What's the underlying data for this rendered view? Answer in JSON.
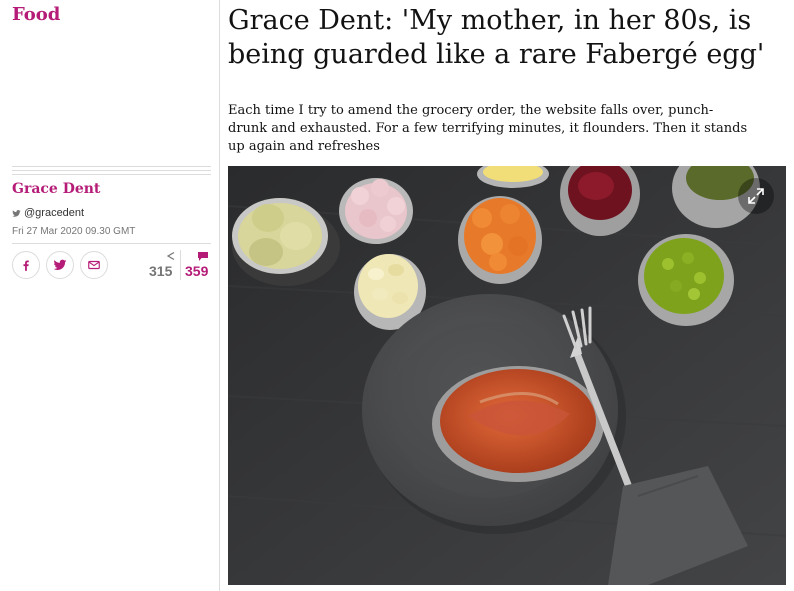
{
  "section": {
    "title": "Food"
  },
  "article": {
    "headline": "Grace Dent: 'My mother, in her 80s, is being guarded like a rare Fabergé egg'",
    "standfirst": "Each time I try to amend the grocery order, the website falls over, punch-drunk and exhausted. For a few terrifying minutes, it flounders. Then it stands up again and refreshes"
  },
  "byline": {
    "author": "Grace Dent",
    "twitter": "@gracedent",
    "date": "Fri 27 Mar 2020 09.30 GMT"
  },
  "share": {
    "buttons": [
      "facebook-icon",
      "twitter-icon",
      "email-icon"
    ],
    "share_count": "315",
    "comment_count": "359"
  },
  "colors": {
    "accent": "#b51c77",
    "text": "#121212",
    "muted": "#767676",
    "rule": "#dcdcdc"
  }
}
